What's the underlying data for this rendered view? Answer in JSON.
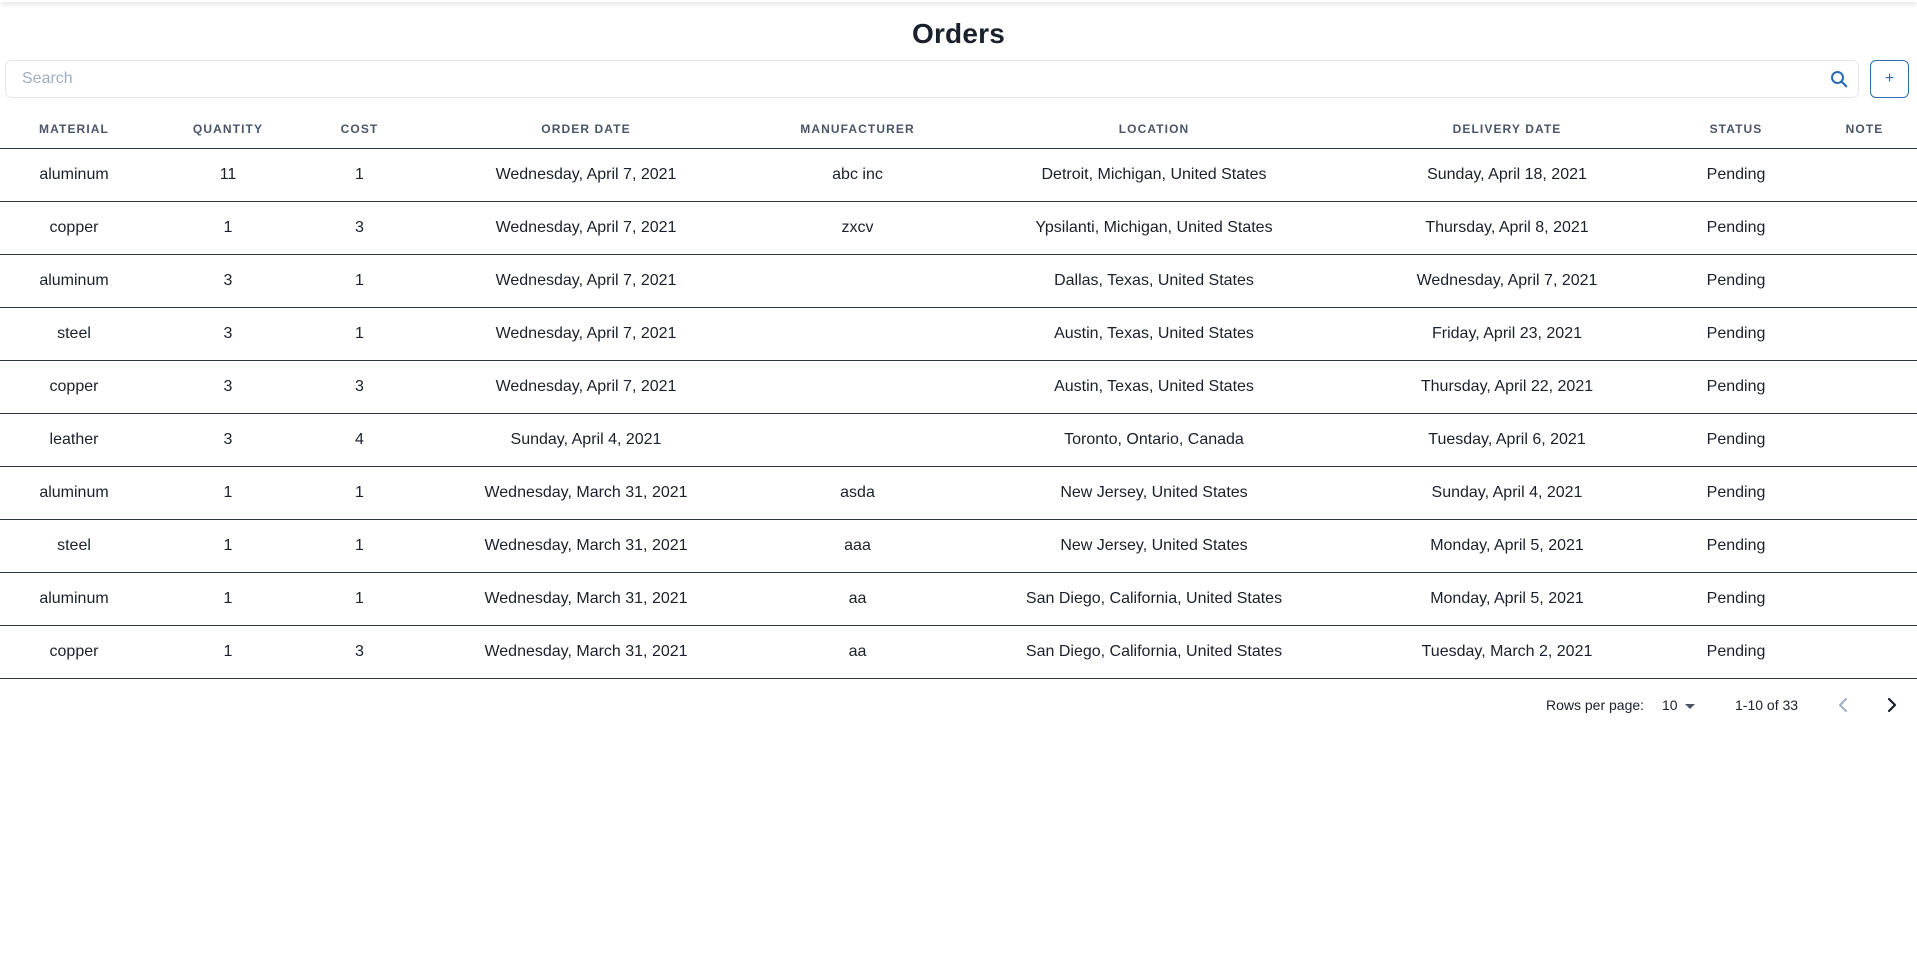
{
  "page": {
    "title": "Orders"
  },
  "search": {
    "placeholder": "Search",
    "value": "",
    "icon": "search-icon"
  },
  "toolbar": {
    "add_label": "+"
  },
  "table": {
    "columns": [
      "Material",
      "Quantity",
      "Cost",
      "Order Date",
      "Manufacturer",
      "Location",
      "Delivery Date",
      "Status",
      "Note"
    ],
    "rows": [
      [
        "aluminum",
        "11",
        "1",
        "Wednesday, April 7, 2021",
        "abc inc",
        "Detroit, Michigan, United States",
        "Sunday, April 18, 2021",
        "Pending",
        ""
      ],
      [
        "copper",
        "1",
        "3",
        "Wednesday, April 7, 2021",
        "zxcv",
        "Ypsilanti, Michigan, United States",
        "Thursday, April 8, 2021",
        "Pending",
        ""
      ],
      [
        "aluminum",
        "3",
        "1",
        "Wednesday, April 7, 2021",
        "",
        "Dallas, Texas, United States",
        "Wednesday, April 7, 2021",
        "Pending",
        ""
      ],
      [
        "steel",
        "3",
        "1",
        "Wednesday, April 7, 2021",
        "",
        "Austin, Texas, United States",
        "Friday, April 23, 2021",
        "Pending",
        ""
      ],
      [
        "copper",
        "3",
        "3",
        "Wednesday, April 7, 2021",
        "",
        "Austin, Texas, United States",
        "Thursday, April 22, 2021",
        "Pending",
        ""
      ],
      [
        "leather",
        "3",
        "4",
        "Sunday, April 4, 2021",
        "",
        "Toronto, Ontario, Canada",
        "Tuesday, April 6, 2021",
        "Pending",
        ""
      ],
      [
        "aluminum",
        "1",
        "1",
        "Wednesday, March 31, 2021",
        "asda",
        "New Jersey, United States",
        "Sunday, April 4, 2021",
        "Pending",
        ""
      ],
      [
        "steel",
        "1",
        "1",
        "Wednesday, March 31, 2021",
        "aaa",
        "New Jersey, United States",
        "Monday, April 5, 2021",
        "Pending",
        ""
      ],
      [
        "aluminum",
        "1",
        "1",
        "Wednesday, March 31, 2021",
        "aa",
        "San Diego, California, United States",
        "Monday, April 5, 2021",
        "Pending",
        ""
      ],
      [
        "copper",
        "1",
        "3",
        "Wednesday, March 31, 2021",
        "aa",
        "San Diego, California, United States",
        "Tuesday, March 2, 2021",
        "Pending",
        ""
      ]
    ]
  },
  "pagination": {
    "rows_per_page_label": "Rows per page:",
    "rows_per_page_value": "10",
    "range_text": "1-10 of 33",
    "prev_icon": "chevron-left-icon",
    "next_icon": "chevron-right-icon"
  },
  "colors": {
    "accent": "#2b6cb0",
    "text": "#1a202c",
    "header_text": "#4a5568",
    "row_border": "#2d3748",
    "input_border": "#e2e8f0",
    "placeholder": "#a0aec0"
  }
}
